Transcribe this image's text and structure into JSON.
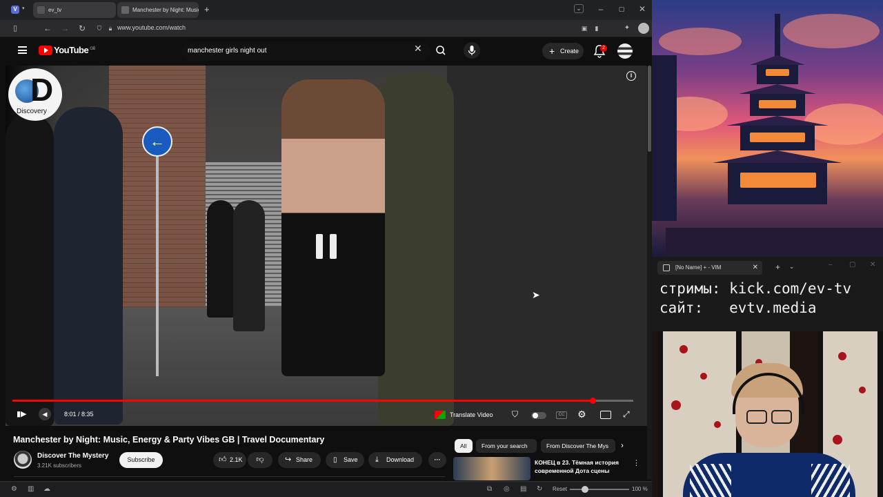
{
  "browser": {
    "tabs": [
      {
        "label": "ev_tv"
      },
      {
        "label": "Manchester by Night: Music"
      }
    ],
    "url": "www.youtube.com/watch"
  },
  "youtube": {
    "logo_text": "YouTube",
    "region": "GB",
    "search_value": "manchester girls night out",
    "create_label": "Create",
    "notification_count": "2"
  },
  "video": {
    "channel_watermark": "Discovery",
    "time_current": "8:01",
    "time_total": "8:35",
    "time_display": "8:01 / 8:35",
    "progress_fraction": 0.934,
    "translate_label": "Translate Video",
    "title": "Manchester by Night: Music, Energy & Party Vibes GB | Travel Documentary",
    "channel": {
      "name": "Discover The Mystery",
      "subscribers": "3.21K subscribers"
    },
    "subscribe_label": "Subscribe",
    "actions": {
      "likes": "2.1K",
      "share": "Share",
      "save": "Save",
      "download": "Download"
    }
  },
  "recommendations": {
    "chips": [
      "All",
      "From your search",
      "From Discover The Mys"
    ],
    "first_title": "КОНЕЦ в 23. Тёмная история современной Дота сцены"
  },
  "statusbar": {
    "reset_label": "Reset",
    "zoom": "100 %",
    "zoom_fraction": 0.2
  },
  "vim": {
    "tab_title": "[No Name] + - VIM",
    "lines": [
      "стримы: kick.com/ev-tv",
      "сайт:   evtv.media"
    ]
  },
  "icons": {
    "menu": "hamburger-icon",
    "search": "search-icon",
    "mic": "mic-icon",
    "bell": "bell-icon"
  },
  "colors": {
    "youtube_red": "#ff0000",
    "background": "#0f0f0f",
    "chip_bg": "#272727"
  }
}
